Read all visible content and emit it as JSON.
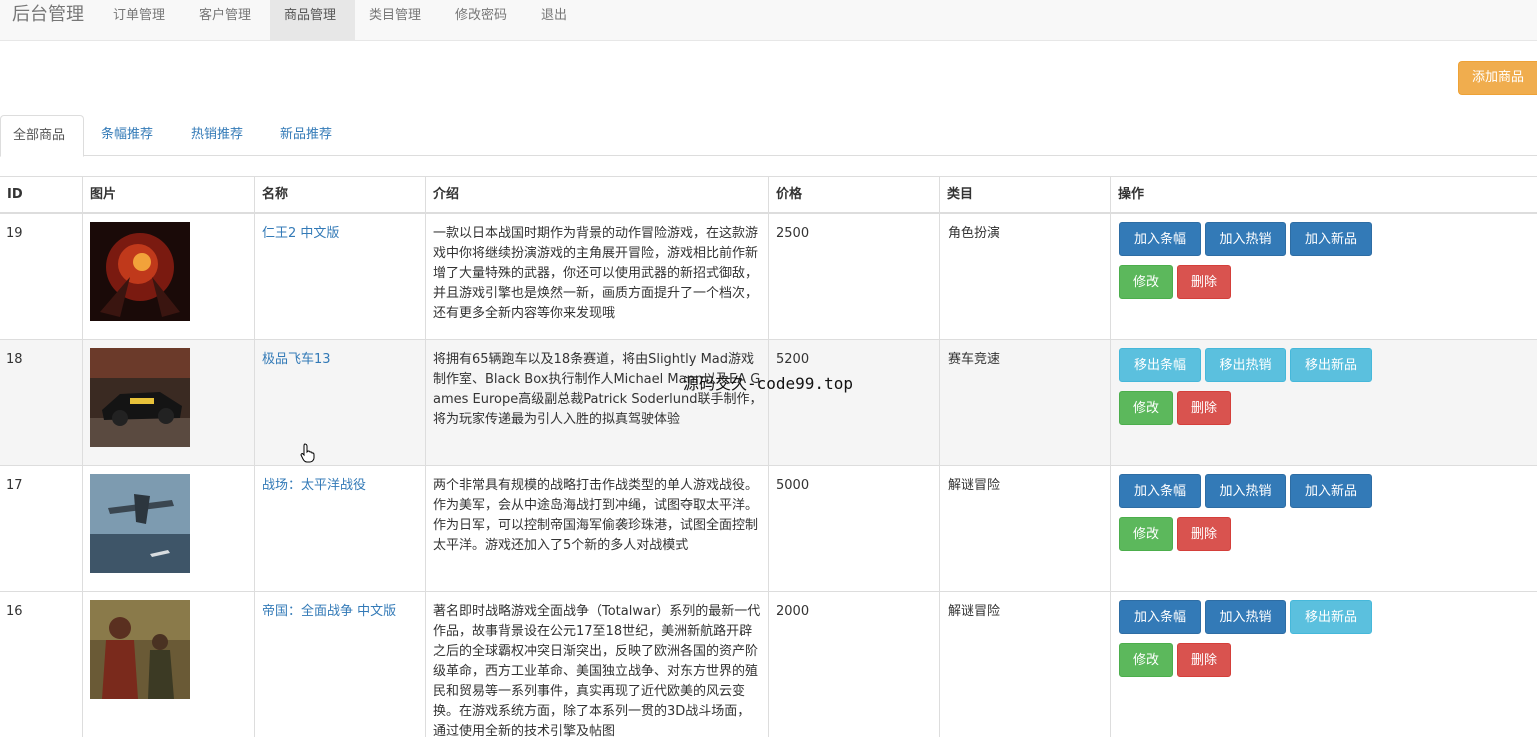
{
  "navbar": {
    "brand": "后台管理",
    "items": [
      "订单管理",
      "客户管理",
      "商品管理",
      "类目管理",
      "修改密码",
      "退出"
    ],
    "active_index": 2
  },
  "toolbar": {
    "add_label": "添加商品"
  },
  "tabs": {
    "items": [
      "全部商品",
      "条幅推荐",
      "热销推荐",
      "新品推荐"
    ],
    "active_index": 0
  },
  "table": {
    "headers": [
      "ID",
      "图片",
      "名称",
      "介绍",
      "价格",
      "类目",
      "操作"
    ],
    "rows": [
      {
        "id": "19",
        "name": "仁王2 中文版",
        "desc": "一款以日本战国时期作为背景的动作冒险游戏，在这款游戏中你将继续扮演游戏的主角展开冒险，游戏相比前作新增了大量特殊的武器，你还可以使用武器的新招式御敌，并且游戏引擎也是焕然一新，画质方面提升了一个档次，还有更多全新内容等你来发现哦",
        "price": "2500",
        "category": "角色扮演",
        "actions": [
          {
            "label": "加入条幅",
            "color": "blue"
          },
          {
            "label": "加入热销",
            "color": "blue"
          },
          {
            "label": "加入新品",
            "color": "blue"
          }
        ],
        "edit_label": "修改",
        "delete_label": "删除",
        "image_icon": "fiery-warrior-image"
      },
      {
        "id": "18",
        "name": "极品飞车13",
        "desc": "将拥有65辆跑车以及18条赛道，将由Slightly Mad游戏制作室、Black Box执行制作人Michael Mann以及EA Games Europe高级副总裁Patrick Soderlund联手制作，将为玩家传递最为引人入胜的拟真驾驶体验",
        "price": "5200",
        "category": "赛车竞速",
        "actions": [
          {
            "label": "移出条幅",
            "color": "cyan"
          },
          {
            "label": "移出热销",
            "color": "cyan"
          },
          {
            "label": "移出新品",
            "color": "cyan"
          }
        ],
        "edit_label": "修改",
        "delete_label": "删除",
        "image_icon": "race-car-image"
      },
      {
        "id": "17",
        "name": "战场：太平洋战役",
        "desc": "两个非常具有规模的战略打击作战类型的单人游戏战役。作为美军，会从中途岛海战打到冲绳，试图夺取太平洋。作为日军，可以控制帝国海军偷袭珍珠港，试图全面控制太平洋。游戏还加入了5个新的多人对战模式",
        "price": "5000",
        "category": "解谜冒险",
        "actions": [
          {
            "label": "加入条幅",
            "color": "blue"
          },
          {
            "label": "加入热销",
            "color": "blue"
          },
          {
            "label": "加入新品",
            "color": "blue"
          }
        ],
        "edit_label": "修改",
        "delete_label": "删除",
        "image_icon": "warplane-image"
      },
      {
        "id": "16",
        "name": "帝国：全面战争 中文版",
        "desc": "著名即时战略游戏全面战争（Totalwar）系列的最新一代作品，故事背景设在公元17至18世纪，美洲新航路开辟之后的全球霸权冲突日渐突出，反映了欧洲各国的资产阶级革命，西方工业革命、美国独立战争、对东方世界的殖民和贸易等一系列事件，真实再现了近代欧美的风云变换。在游戏系统方面，除了本系列一贯的3D战斗场面，通过使用全新的技术引擎及帖图",
        "price": "2000",
        "category": "解谜冒险",
        "actions": [
          {
            "label": "加入条幅",
            "color": "blue"
          },
          {
            "label": "加入热销",
            "color": "blue"
          },
          {
            "label": "移出新品",
            "color": "cyan"
          }
        ],
        "edit_label": "修改",
        "delete_label": "删除",
        "image_icon": "soldier-image"
      }
    ]
  },
  "watermark": "源码交久-code99.top",
  "colors": {
    "primary": "#337ab7",
    "info": "#5bc0de",
    "success": "#5cb85c",
    "danger": "#d9534f",
    "warning": "#f0ad4e"
  }
}
